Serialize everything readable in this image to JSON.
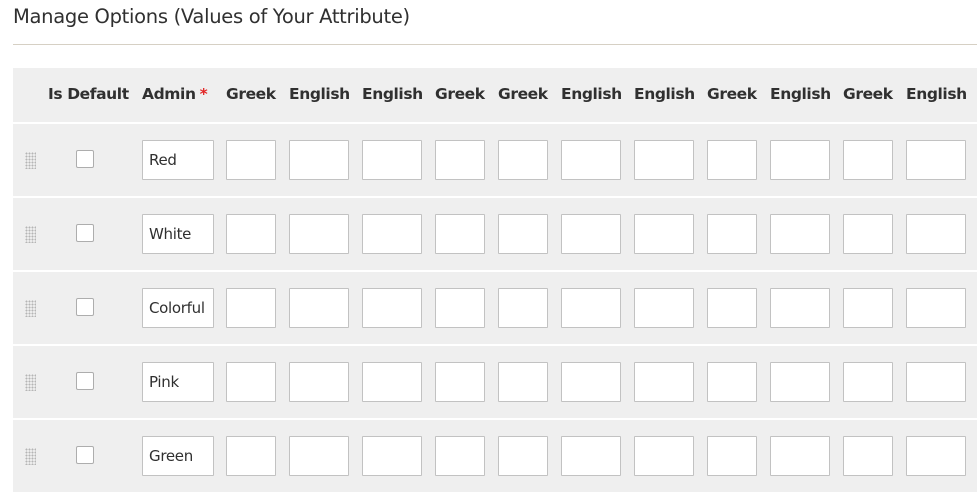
{
  "section": {
    "title": "Manage Options (Values of Your Attribute)"
  },
  "table": {
    "headers": {
      "is_default": "Is Default",
      "admin": "Admin",
      "required_marker": "*",
      "stores": [
        "Greek",
        "English",
        "English",
        "Greek",
        "Greek",
        "English",
        "English",
        "Greek",
        "English",
        "Greek",
        "English"
      ]
    },
    "rows": [
      {
        "admin_value": "Red",
        "is_default": false,
        "store_values": [
          "",
          "",
          "",
          "",
          "",
          "",
          "",
          "",
          "",
          "",
          ""
        ]
      },
      {
        "admin_value": "White",
        "is_default": false,
        "store_values": [
          "",
          "",
          "",
          "",
          "",
          "",
          "",
          "",
          "",
          "",
          ""
        ]
      },
      {
        "admin_value": "Colorful",
        "is_default": false,
        "store_values": [
          "",
          "",
          "",
          "",
          "",
          "",
          "",
          "",
          "",
          "",
          ""
        ]
      },
      {
        "admin_value": "Pink",
        "is_default": false,
        "store_values": [
          "",
          "",
          "",
          "",
          "",
          "",
          "",
          "",
          "",
          "",
          ""
        ]
      },
      {
        "admin_value": "Green",
        "is_default": false,
        "store_values": [
          "",
          "",
          "",
          "",
          "",
          "",
          "",
          "",
          "",
          "",
          ""
        ]
      }
    ]
  },
  "colors": {
    "required": "#e22626",
    "row_background": "#efefef",
    "text": "#303030"
  }
}
